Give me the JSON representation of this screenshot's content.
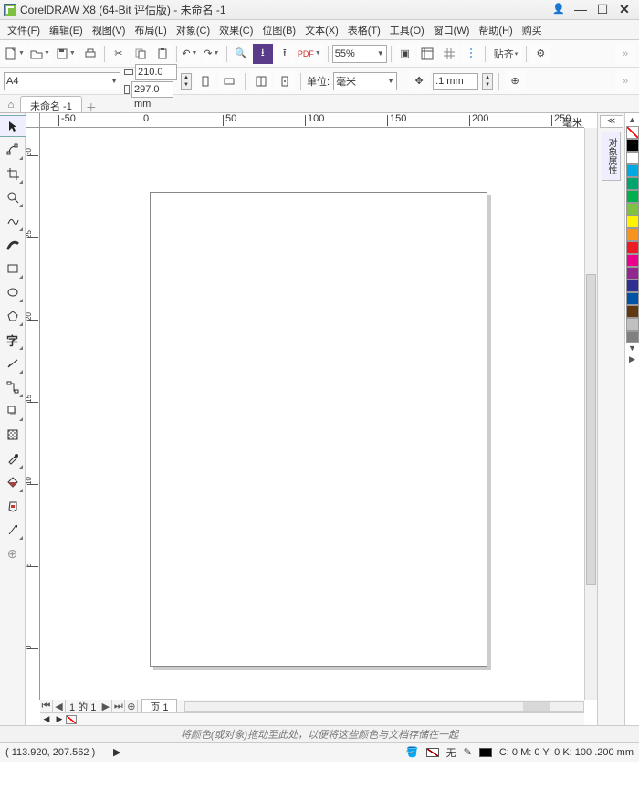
{
  "title": "CorelDRAW X8 (64-Bit 评估版) - 未命名 -1",
  "menu": [
    "文件(F)",
    "编辑(E)",
    "视图(V)",
    "布局(L)",
    "对象(C)",
    "效果(C)",
    "位图(B)",
    "文本(X)",
    "表格(T)",
    "工具(O)",
    "窗口(W)",
    "帮助(H)",
    "购买"
  ],
  "toolbar1": {
    "zoom": "55%",
    "snap": "贴齐"
  },
  "propbar": {
    "preset": "A4",
    "width": "210.0 mm",
    "height": "297.0 mm",
    "unitlabel": "单位:",
    "unit": "毫米",
    "nudge": ".1 mm"
  },
  "doctab": "未命名 -1",
  "ruler": {
    "h": [
      "-50",
      "0",
      "50",
      "100",
      "150",
      "200",
      "250",
      "毫米"
    ],
    "v": [
      "30",
      "25",
      "20",
      "15",
      "10",
      "5",
      "0"
    ]
  },
  "pagenav": {
    "text": "1 的 1",
    "tab": "页 1"
  },
  "rside": {
    "flyout": "≪",
    "tab": "对象属性"
  },
  "hint": "将颜色(或对象)拖动至此处，以便将这些颜色与文档存储在一起",
  "status": {
    "coord": "( 113.920, 207.562 )",
    "fill": "无",
    "outline": "C: 0 M: 0 Y: 0 K: 100  .200 mm"
  },
  "palette": [
    "#000000",
    "#ffffff",
    "#00a9e0",
    "#00a56d",
    "#00b04f",
    "#7fc241",
    "#fff200",
    "#f7941d",
    "#ed1c24",
    "#ec008c",
    "#92278f",
    "#2e3192",
    "#0054a6",
    "#603913",
    "#c0c0c0",
    "#808080"
  ]
}
